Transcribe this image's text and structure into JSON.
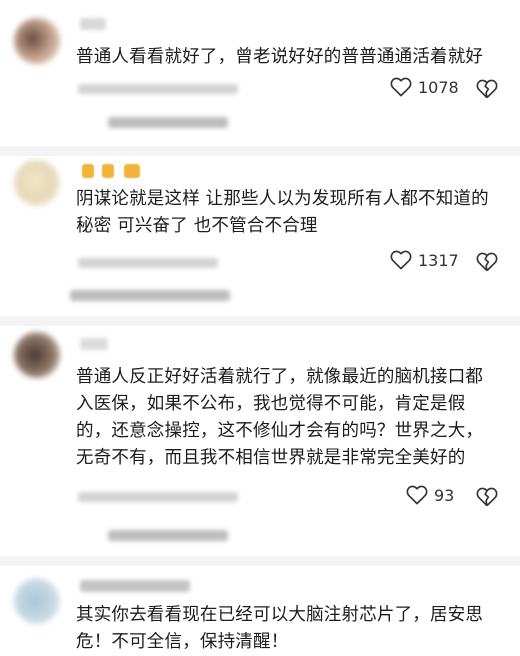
{
  "comments": [
    {
      "text": "普通人看看就好了，曾老说好好的普普通通活着就好",
      "likes": "1078"
    },
    {
      "text": "阴谋论就是这样 让那些人以为发现所有人都不知道的秘密 可兴奋了 也不管合不合理",
      "likes": "1317"
    },
    {
      "text": "普通人反正好好活着就行了，就像最近的脑机接口都入医保，如果不公布，我也觉得不可能，肯定是假的，还意念操控，这不修仙才会有的吗？世界之大，无奇不有，而且我不相信世界就是非常完全美好的",
      "likes": "93"
    },
    {
      "text": "其实你去看看现在已经可以大脑注射芯片了，居安思危！不可全信，保持清醒！"
    }
  ],
  "icons": {
    "like": "heart-outline-icon",
    "dislike": "broken-heart-icon"
  },
  "colors": {
    "text": "#1c1c1c",
    "badge": "#f2b33b",
    "divider": "#f4f4f4"
  }
}
